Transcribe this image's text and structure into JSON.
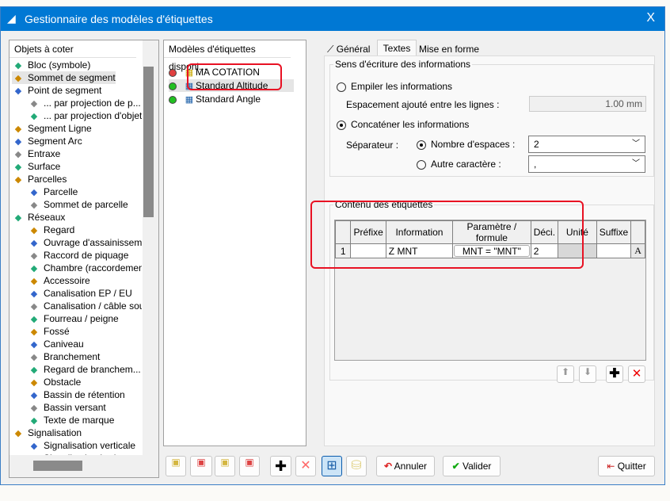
{
  "window": {
    "title": "Gestionnaire des modèles d'étiquettes",
    "close": "X"
  },
  "objects": {
    "header": "Objets à coter",
    "items": [
      {
        "label": "Bloc (symbole)",
        "level": 0,
        "icon": "block-symbol-icon"
      },
      {
        "label": "Sommet de segment",
        "level": 0,
        "icon": "segment-vertex-icon",
        "selected": true
      },
      {
        "label": "Point de segment",
        "level": 0,
        "icon": "segment-point-icon"
      },
      {
        "label": "... par projection de p...",
        "level": 1,
        "icon": "projection-point-icon"
      },
      {
        "label": "... par projection d'objet",
        "level": 1,
        "icon": "projection-object-icon"
      },
      {
        "label": "Segment Ligne",
        "level": 0,
        "icon": "line-segment-icon"
      },
      {
        "label": "Segment Arc",
        "level": 0,
        "icon": "arc-segment-icon"
      },
      {
        "label": "Entraxe",
        "level": 0,
        "icon": "center-distance-icon"
      },
      {
        "label": "Surface",
        "level": 0,
        "icon": "surface-icon"
      },
      {
        "label": "Parcelles",
        "level": 0,
        "icon": "parcels-icon"
      },
      {
        "label": "Parcelle",
        "level": 1,
        "icon": "parcel-icon"
      },
      {
        "label": "Sommet de parcelle",
        "level": 1,
        "icon": "parcel-vertex-icon"
      },
      {
        "label": "Réseaux",
        "level": 0,
        "icon": "networks-icon"
      },
      {
        "label": "Regard",
        "level": 1,
        "icon": "manhole-icon"
      },
      {
        "label": "Ouvrage d'assainissem...",
        "level": 1,
        "icon": "sanitation-icon"
      },
      {
        "label": "Raccord de piquage",
        "level": 1,
        "icon": "tap-connection-icon"
      },
      {
        "label": "Chambre (raccordement",
        "level": 1,
        "icon": "chamber-icon"
      },
      {
        "label": "Accessoire",
        "level": 1,
        "icon": "accessory-icon"
      },
      {
        "label": "Canalisation EP / EU",
        "level": 1,
        "icon": "pipe-icon"
      },
      {
        "label": "Canalisation / câble sou...",
        "level": 1,
        "icon": "cable-icon"
      },
      {
        "label": "Fourreau / peigne",
        "level": 1,
        "icon": "sheath-icon"
      },
      {
        "label": "Fossé",
        "level": 1,
        "icon": "ditch-icon"
      },
      {
        "label": "Caniveau",
        "level": 1,
        "icon": "gutter-icon"
      },
      {
        "label": "Branchement",
        "level": 1,
        "icon": "branch-icon"
      },
      {
        "label": "Regard de branchem...",
        "level": 1,
        "icon": "branch-manhole-icon"
      },
      {
        "label": "Obstacle",
        "level": 1,
        "icon": "obstacle-icon"
      },
      {
        "label": "Bassin de rétention",
        "level": 1,
        "icon": "retention-basin-icon"
      },
      {
        "label": "Bassin versant",
        "level": 1,
        "icon": "watershed-icon"
      },
      {
        "label": "Texte de marque",
        "level": 1,
        "icon": "mark-text-icon"
      },
      {
        "label": "Signalisation",
        "level": 0,
        "icon": "signage-icon"
      },
      {
        "label": "Signalisation verticale",
        "level": 1,
        "icon": "vertical-signage-icon"
      },
      {
        "label": "Signalisation horizont",
        "level": 1,
        "icon": "horizontal-signage-icon"
      }
    ]
  },
  "models": {
    "header": "Modèles d'étiquettes disponi...",
    "items": [
      {
        "label": "MA COTATION",
        "status": "#e04040"
      },
      {
        "label": "Standard Altitude",
        "status": "#22c022",
        "selected": true
      },
      {
        "label": "Standard Angle",
        "status": "#22c022"
      }
    ]
  },
  "tabs": [
    "Général",
    "Textes",
    "Mise en forme"
  ],
  "sens": {
    "title": "Sens d'écriture des informations",
    "empiler": "Empiler les informations",
    "espacement_label": "Espacement ajouté entre les lignes :",
    "espacement_value": "1.00 mm",
    "concatener": "Concaténer les informations",
    "separateur": "Séparateur :",
    "nb_espaces": "Nombre d'espaces :",
    "nb_espaces_value": "2",
    "autre": "Autre caractère :",
    "autre_value": ","
  },
  "contenu": {
    "title": "Contenu des étiquettes",
    "columns": [
      "Préfixe",
      "Information",
      "Paramètre / formule",
      "Déci.",
      "Unité",
      "Suffixe"
    ],
    "rows": [
      {
        "num": "1",
        "prefixe": "",
        "information": "Z MNT",
        "formule": "MNT = \"MNT\"",
        "deci": "2",
        "unite": "",
        "suffixe": ""
      }
    ]
  },
  "buttons": {
    "annuler": "Annuler",
    "valider": "Valider",
    "quitter": "Quitter"
  }
}
